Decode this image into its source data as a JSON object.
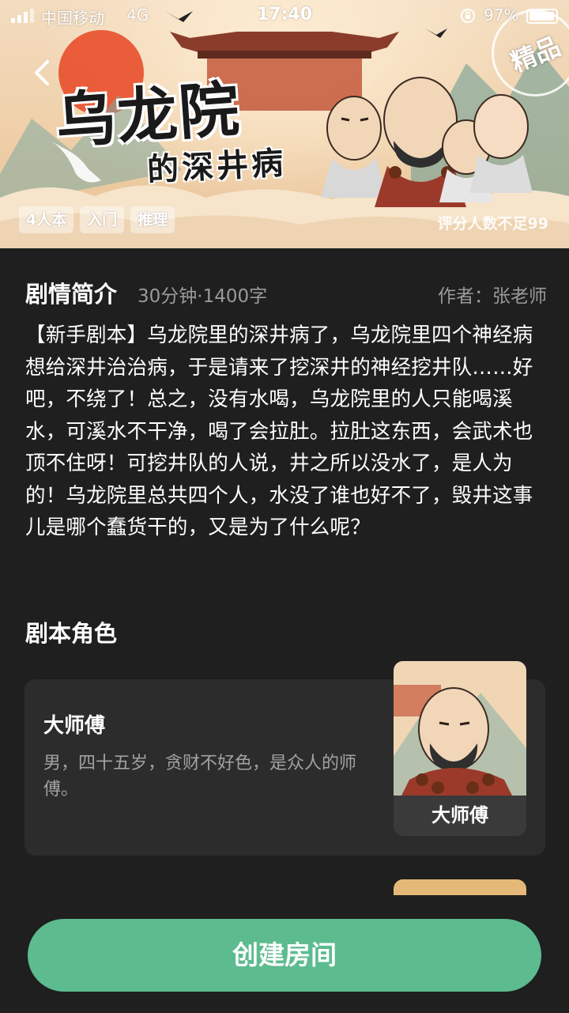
{
  "status_bar": {
    "carrier": "中国移动",
    "network": "4G",
    "time": "17:40",
    "battery_percent": "97%",
    "battery_level": 0.97
  },
  "banner": {
    "title_main": "乌龙院",
    "title_sub": "的深井病",
    "seal_text": "精品",
    "tags": [
      "4人本",
      "入门",
      "推理"
    ],
    "rating_note": "评分人数不足99"
  },
  "synopsis": {
    "heading": "剧情简介",
    "meta": "30分钟·1400字",
    "author": "作者：张老师",
    "text": "【新手剧本】乌龙院里的深井病了，乌龙院里四个神经病想给深井治治病，于是请来了挖深井的神经挖井队……好吧，不绕了！总之，没有水喝，乌龙院里的人只能喝溪水，可溪水不干净，喝了会拉肚。拉肚这东西，会武术也顶不住呀！可挖井队的人说，井之所以没水了，是人为的！乌龙院里总共四个人，水没了谁也好不了，毁井这事儿是哪个蠢货干的，又是为了什么呢？"
  },
  "roles": {
    "heading": "剧本角色",
    "items": [
      {
        "name": "大师傅",
        "description": "男，四十五岁，贪财不好色，是众人的师傅。",
        "portrait_label": "大师傅"
      }
    ]
  },
  "footer": {
    "create_button": "创建房间"
  },
  "colors": {
    "background": "#1f1f1f",
    "card": "#2c2c2c",
    "accent": "#5cbb8f",
    "muted_text": "#9a9a9a"
  }
}
